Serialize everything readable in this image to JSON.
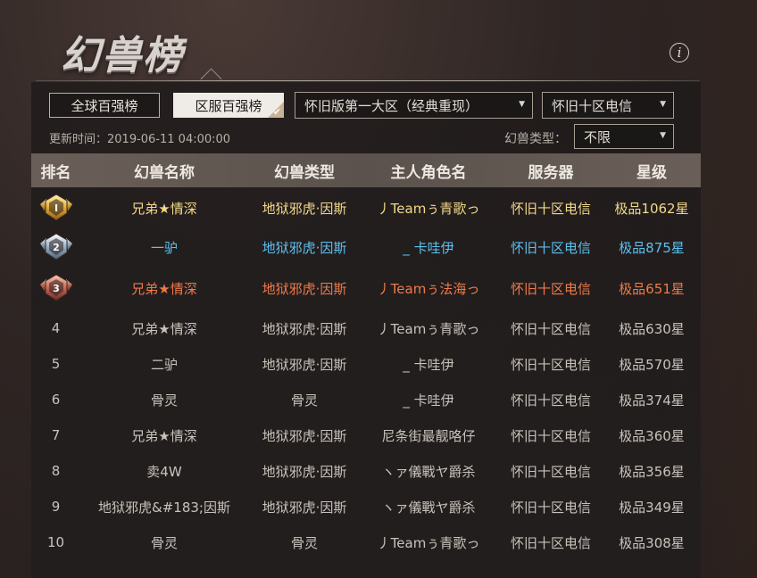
{
  "page": {
    "title": "幻兽榜"
  },
  "controls": {
    "global_tab": "全球百强榜",
    "server_tab": "区服百强榜",
    "region_select": "怀旧版第一大区（经典重现）",
    "server_select": "怀旧十区电信",
    "updated": "更新时间：2019-06-11 04:00:00",
    "type_label": "幻兽类型：",
    "type_select": "不限"
  },
  "columns": [
    "排名",
    "幻兽名称",
    "幻兽类型",
    "主人角色名",
    "服务器",
    "星级"
  ],
  "colors": {
    "gold": "#f2d98a",
    "silver": "#5cc0ee",
    "bronze": "#ee7a4a",
    "normal": "#c9c2bb"
  },
  "rows": [
    {
      "rank": "1",
      "medal": "gold-medal-icon",
      "name": "兄弟★情深",
      "type": "地狱邪虎·因斯",
      "owner": "丿Teamぅ青歌っ",
      "server": "怀旧十区电信",
      "stars": "极品1062星"
    },
    {
      "rank": "2",
      "medal": "silver-medal-icon",
      "name": "一驴",
      "type": "地狱邪虎·因斯",
      "owner": "_ 卡哇伊",
      "server": "怀旧十区电信",
      "stars": "极品875星"
    },
    {
      "rank": "3",
      "medal": "bronze-medal-icon",
      "name": "兄弟★情深",
      "type": "地狱邪虎·因斯",
      "owner": "丿Teamぅ法海っ",
      "server": "怀旧十区电信",
      "stars": "极品651星"
    },
    {
      "rank": "4",
      "name": "兄弟★情深",
      "type": "地狱邪虎·因斯",
      "owner": "丿Teamぅ青歌っ",
      "server": "怀旧十区电信",
      "stars": "极品630星"
    },
    {
      "rank": "5",
      "name": "二驴",
      "type": "地狱邪虎·因斯",
      "owner": "_ 卡哇伊",
      "server": "怀旧十区电信",
      "stars": "极品570星"
    },
    {
      "rank": "6",
      "name": "骨灵",
      "type": "骨灵",
      "owner": "_ 卡哇伊",
      "server": "怀旧十区电信",
      "stars": "极品374星"
    },
    {
      "rank": "7",
      "name": "兄弟★情深",
      "type": "地狱邪虎·因斯",
      "owner": "尼条街最靓咯仔",
      "server": "怀旧十区电信",
      "stars": "极品360星"
    },
    {
      "rank": "8",
      "name": "卖4W",
      "type": "地狱邪虎·因斯",
      "owner": "ヽァ儀戰ヤ爵杀",
      "server": "怀旧十区电信",
      "stars": "极品356星"
    },
    {
      "rank": "9",
      "name": "地狱邪虎&#183;因斯",
      "type": "地狱邪虎·因斯",
      "owner": "ヽァ儀戰ヤ爵杀",
      "server": "怀旧十区电信",
      "stars": "极品349星"
    },
    {
      "rank": "10",
      "name": "骨灵",
      "type": "骨灵",
      "owner": "丿Teamぅ青歌っ",
      "server": "怀旧十区电信",
      "stars": "极品308星"
    }
  ]
}
